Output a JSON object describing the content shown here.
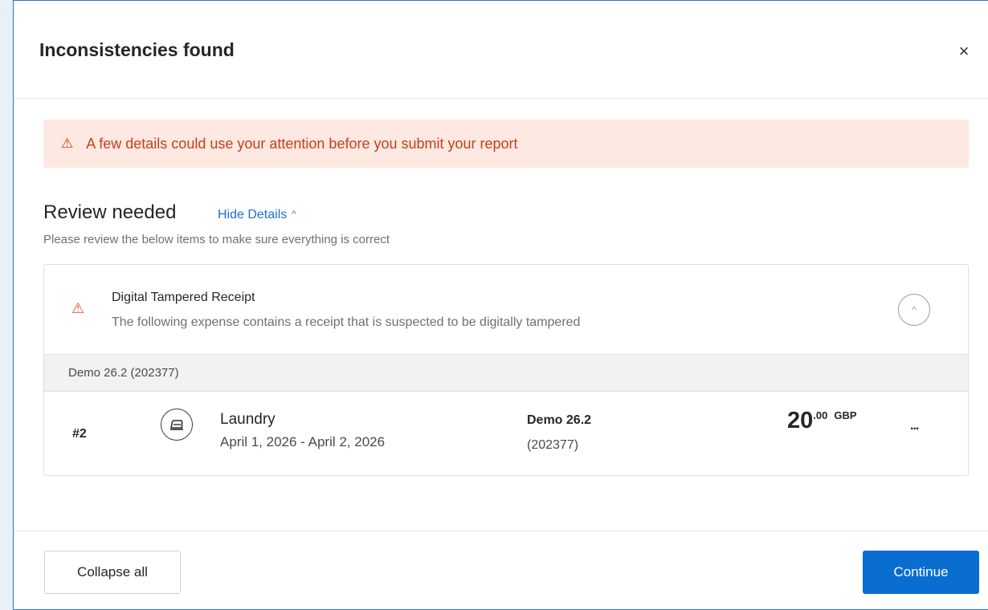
{
  "dialog": {
    "title": "Inconsistencies found",
    "close_icon": "×"
  },
  "banner": {
    "icon": "⚠",
    "text": "A few details could use your attention before you submit your report"
  },
  "review": {
    "title": "Review needed",
    "toggle_label": "Hide Details",
    "toggle_icon": "^",
    "subtitle": "Please review the below items to make sure everything is correct"
  },
  "issue": {
    "icon": "⚠",
    "title": "Digital Tampered Receipt",
    "description": "The following expense contains a receipt that is suspected to be digitally tampered",
    "collapse_icon": "^",
    "group_label": "Demo 26.2 (202377)",
    "expenses": [
      {
        "number": "#2",
        "icon": "iron-icon",
        "name": "Laundry",
        "dates": "April 1, 2026 - April 2, 2026",
        "report_name": "Demo 26.2",
        "report_id": "(202377)",
        "amount_int": "20",
        "amount_dec": ".00",
        "currency": "GBP",
        "more": "..."
      }
    ]
  },
  "footer": {
    "collapse_all_label": "Collapse all",
    "continue_label": "Continue"
  },
  "colors": {
    "accent": "#0a6ed1",
    "warning_text": "#c3411d",
    "warning_bg": "#fde8e2",
    "link": "#1d6fce"
  }
}
